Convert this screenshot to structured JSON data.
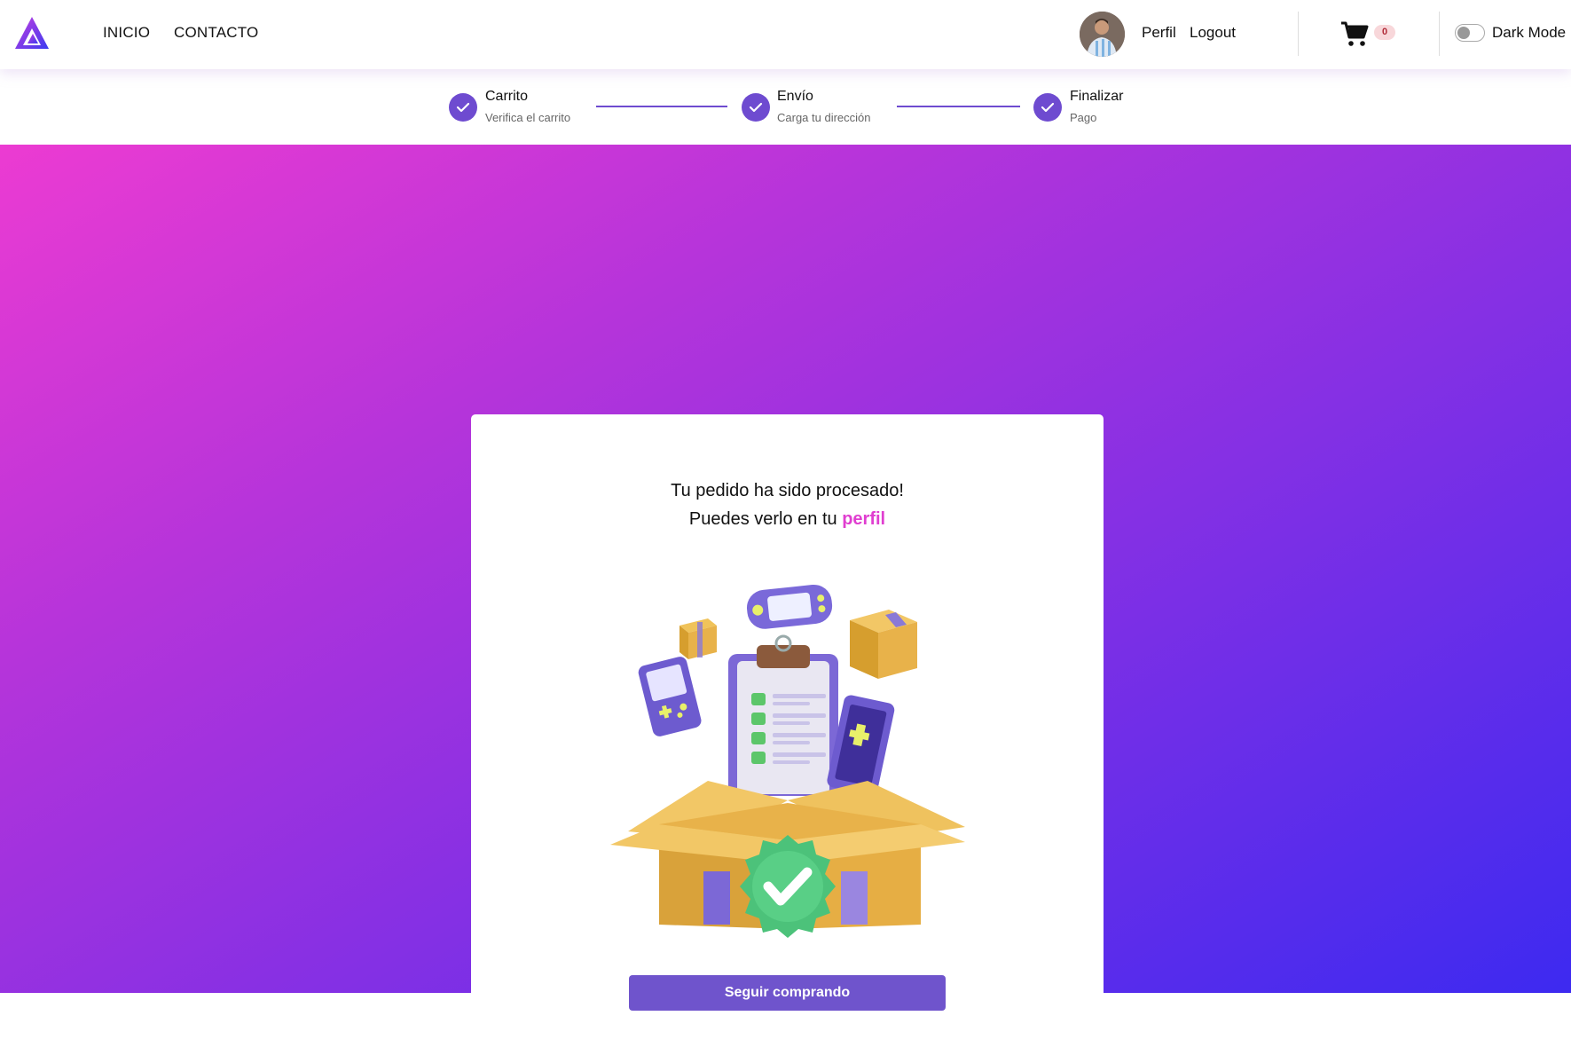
{
  "nav": {
    "logo_icon": "triangle-logo",
    "links": [
      "INICIO",
      "CONTACTO"
    ],
    "perfil": "Perfil",
    "logout": "Logout",
    "cart_icon": "shopping-cart-icon",
    "cart_count": "0",
    "dark_mode_label": "Dark Mode",
    "dark_mode_on": false
  },
  "stepper": {
    "steps": [
      {
        "title": "Carrito",
        "subtitle": "Verifica el carrito",
        "done": true
      },
      {
        "title": "Envío",
        "subtitle": "Carga tu dirección",
        "done": true
      },
      {
        "title": "Finalizar",
        "subtitle": "Pago",
        "done": true
      }
    ]
  },
  "card": {
    "line1": "Tu pedido ha sido procesado!",
    "line2_prefix": "Puedes verlo en tu ",
    "line2_link": "perfil",
    "illustration_icon": "order-box-illustration",
    "button_label": "Seguir comprando"
  },
  "colors": {
    "accent": "#6e4bd0",
    "link_pink": "#e03ed0",
    "gradient_start": "#ec3bd2",
    "gradient_end": "#3d2af0"
  }
}
